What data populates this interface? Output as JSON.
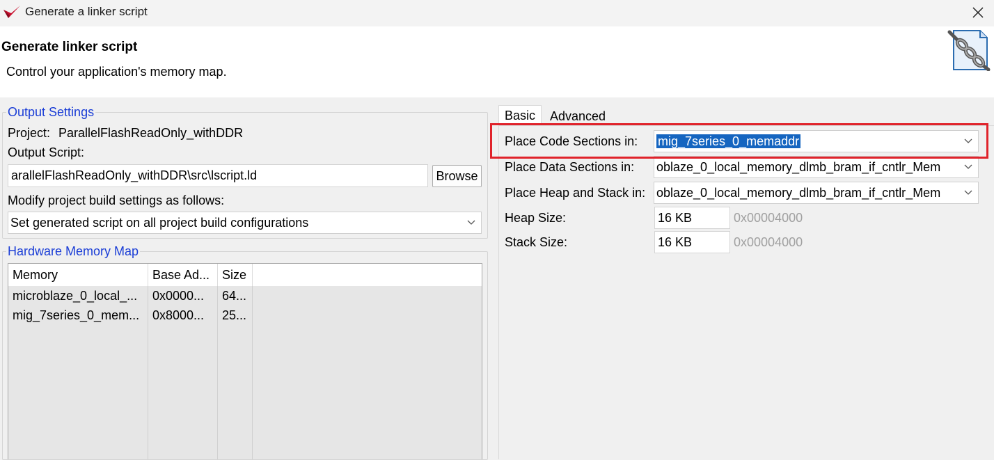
{
  "window": {
    "title": "Generate a linker script",
    "close_icon": "close-icon"
  },
  "header": {
    "title": "Generate linker script",
    "subtitle": "Control your application's memory map.",
    "icon": "chain-link-document-icon"
  },
  "output_settings": {
    "legend": "Output Settings",
    "project_label": "Project:",
    "project_value": "ParallelFlashReadOnly_withDDR",
    "output_script_label": "Output Script:",
    "output_script_value": "arallelFlashReadOnly_withDDR\\src\\lscript.ld",
    "browse_label": "Browse",
    "modify_label": "Modify project build settings as follows:",
    "modify_value": "Set generated script on all project build configurations"
  },
  "hardware_memory_map": {
    "legend": "Hardware Memory Map",
    "columns": [
      "Memory",
      "Base Ad...",
      "Size"
    ],
    "rows": [
      [
        "microblaze_0_local_...",
        "0x0000...",
        "64..."
      ],
      [
        "mig_7series_0_mem...",
        "0x8000...",
        "25..."
      ]
    ]
  },
  "tabs": [
    {
      "label": "Basic",
      "active": true
    },
    {
      "label": "Advanced",
      "active": false
    }
  ],
  "basic": {
    "code_label": "Place Code Sections in:",
    "code_value": "mig_7series_0_memaddr",
    "data_label": "Place Data Sections in:",
    "data_value": "oblaze_0_local_memory_dlmb_bram_if_cntlr_Mem",
    "heap_stack_label": "Place Heap and Stack in:",
    "heap_stack_value": "oblaze_0_local_memory_dlmb_bram_if_cntlr_Mem",
    "heap_size_label": "Heap Size:",
    "heap_size_value": "16 KB",
    "heap_size_hex": "0x00004000",
    "stack_size_label": "Stack Size:",
    "stack_size_value": "16 KB",
    "stack_size_hex": "0x00004000"
  },
  "colors": {
    "highlight": "#e0232b",
    "legend": "#1a3dd6",
    "selection": "#1565c0"
  }
}
